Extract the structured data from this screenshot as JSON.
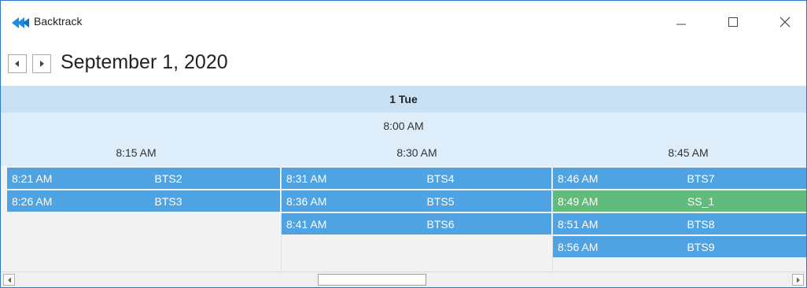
{
  "window": {
    "title": "Backtrack",
    "controls": {
      "minimize_icon": "minimize-icon",
      "maximize_icon": "maximize-icon",
      "close_icon": "close-icon"
    },
    "accent": "#2b78d0"
  },
  "navigation": {
    "date": "September 1, 2020",
    "prev_icon": "caret-left-icon",
    "next_icon": "caret-right-icon"
  },
  "schedule": {
    "day_header": "1 Tue",
    "hour_label": "8:00 AM",
    "slots": [
      {
        "label": "8:15 AM",
        "appointments": [
          {
            "time": "8:21 AM",
            "name": "BTS2",
            "status": "normal"
          },
          {
            "time": "8:26 AM",
            "name": "BTS3",
            "status": "normal"
          }
        ]
      },
      {
        "label": "8:30 AM",
        "appointments": [
          {
            "time": "8:31 AM",
            "name": "BTS4",
            "status": "normal"
          },
          {
            "time": "8:36 AM",
            "name": "BTS5",
            "status": "normal"
          },
          {
            "time": "8:41 AM",
            "name": "BTS6",
            "status": "normal"
          }
        ]
      },
      {
        "label": "8:45 AM",
        "appointments": [
          {
            "time": "8:46 AM",
            "name": "BTS7",
            "status": "normal"
          },
          {
            "time": "8:49 AM",
            "name": "SS_1",
            "status": "highlight"
          },
          {
            "time": "8:51 AM",
            "name": "BTS8",
            "status": "normal"
          },
          {
            "time": "8:56 AM",
            "name": "BTS9",
            "status": "normal"
          }
        ]
      }
    ],
    "colors": {
      "normal": "#4fa3e3",
      "highlight": "#61bb7a",
      "header": "#c9e1f4",
      "timeband": "#ddeefa"
    }
  },
  "scrollbar": {
    "left_icon": "scroll-left-icon",
    "right_icon": "scroll-right-icon"
  }
}
